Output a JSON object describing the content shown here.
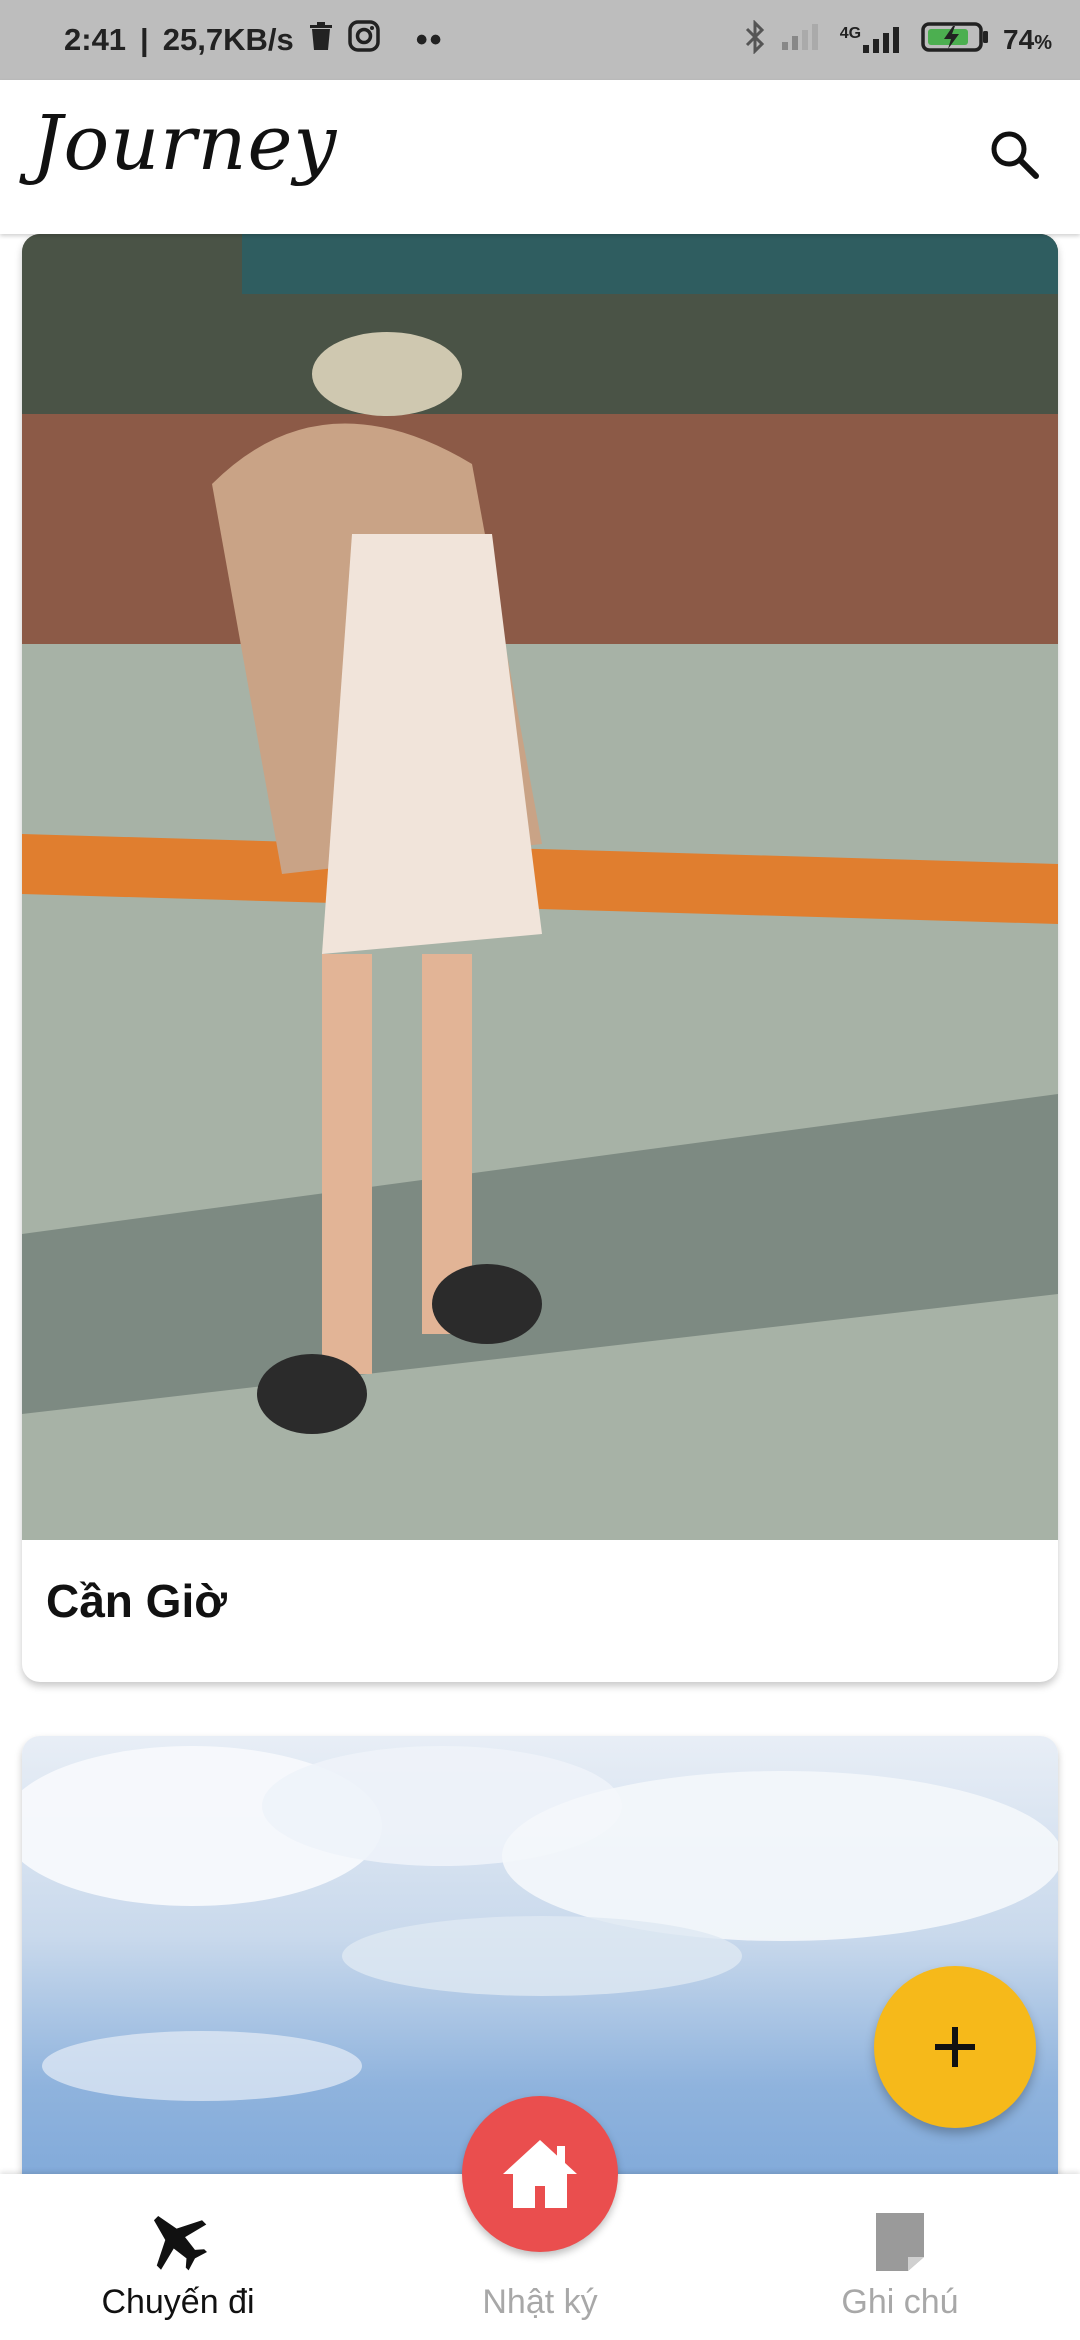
{
  "status_bar": {
    "time": "2:41",
    "network_speed": "25,7KB/s",
    "battery": "74",
    "battery_unit": "%",
    "network_type": "4G",
    "icons": [
      "trash-icon",
      "instagram-icon",
      "bluetooth-icon",
      "signal-icon",
      "battery-icon"
    ]
  },
  "app_bar": {
    "logo": "Journey",
    "search_icon": "search-icon"
  },
  "trips": [
    {
      "title": "Cần Giờ",
      "photo": "photo"
    },
    {
      "title": "",
      "photo": "photo"
    }
  ],
  "fab": {
    "icon": "plus-icon",
    "color": "#f6b91a"
  },
  "bottom_nav": {
    "items": [
      {
        "label": "Chuyến đi",
        "icon": "airplane-icon",
        "active": true
      },
      {
        "label": "Nhật ký",
        "icon": "home-icon",
        "active": false
      },
      {
        "label": "Ghi chú",
        "icon": "note-icon",
        "active": false
      }
    ],
    "home_button_color": "#ea4e4e",
    "active_color": "#111111",
    "inactive_color": "#a8a8a8"
  }
}
